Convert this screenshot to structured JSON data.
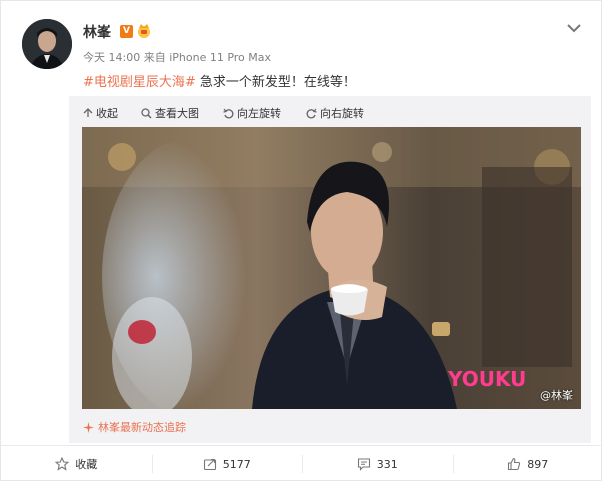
{
  "post": {
    "username": "林峯",
    "verified_badge": "V",
    "timestamp": "今天 14:00",
    "source_prefix": "来自",
    "source": "iPhone 11 Pro Max",
    "hashtag": "#电视剧星辰大海#",
    "text": " 急求一个新发型！在线等！"
  },
  "media_toolbar": {
    "collapse_label": "收起",
    "view_large_label": "查看大图",
    "rotate_left_label": "向左旋转",
    "rotate_right_label": "向右旋转"
  },
  "photo": {
    "watermark_text": "@林峯",
    "logo_text": "YOUKU"
  },
  "follow_link": {
    "label": "林峯最新动态追踪"
  },
  "actions": {
    "favorite_label": "收藏",
    "repost_count": "5177",
    "comment_count": "331",
    "like_count": "897"
  },
  "colors": {
    "accent": "#eb7350",
    "badge": "#f07b17",
    "youku": "#ff3c8f"
  }
}
